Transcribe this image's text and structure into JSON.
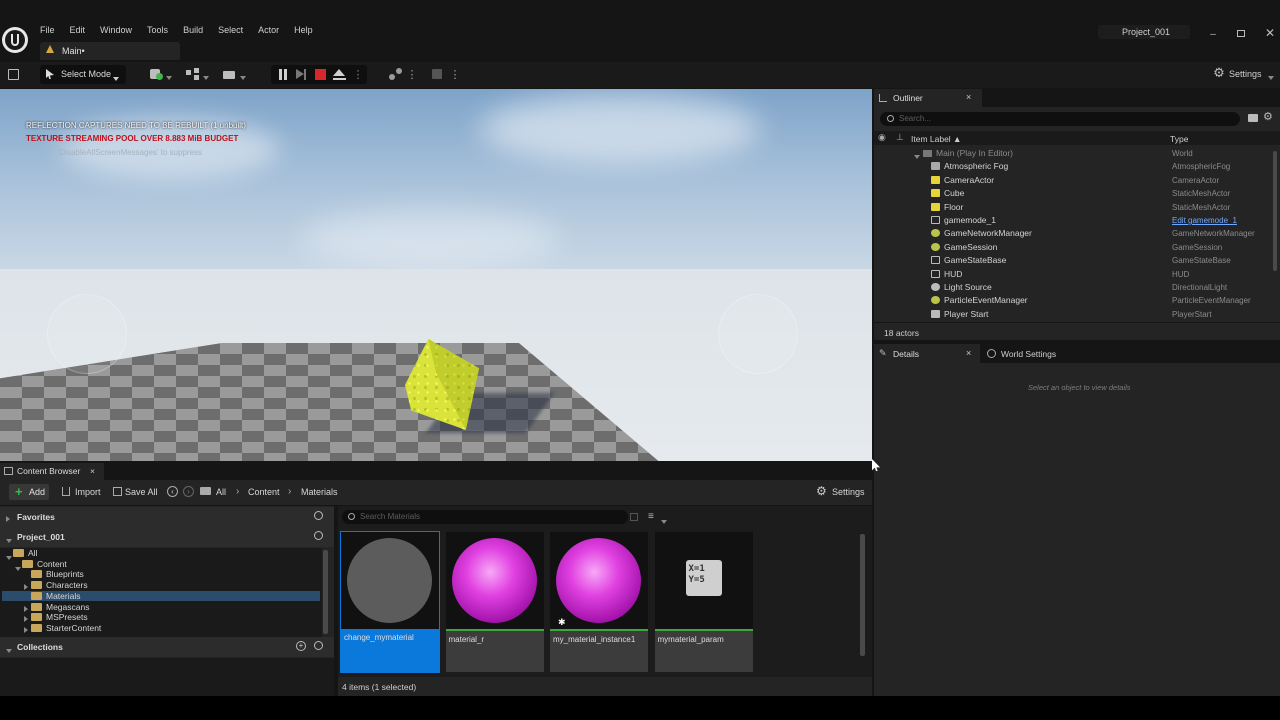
{
  "app": {
    "project_name": "Project_001",
    "tab_label": "Main•"
  },
  "menu": [
    "File",
    "Edit",
    "Window",
    "Tools",
    "Build",
    "Select",
    "Actor",
    "Help"
  ],
  "toolbar": {
    "select_mode": "Select Mode",
    "settings": "Settings"
  },
  "viewport": {
    "messages": [
      "REFLECTION CAPTURES NEED TO BE REBUILT (1 unbuilt)",
      "TEXTURE STREAMING POOL OVER 8.883 MiB BUDGET",
      "'DisableAllScreenMessages' to suppress"
    ]
  },
  "outliner": {
    "tab": "Outliner",
    "search_placeholder": "Search...",
    "col_label": "Item Label ▲",
    "col_type": "Type",
    "root": {
      "label": "Main (Play In Editor)",
      "type": "World"
    },
    "rows": [
      {
        "label": "Atmospheric Fog",
        "type": "AtmosphericFog",
        "icon": "fog-icon"
      },
      {
        "label": "CameraActor",
        "type": "CameraActor",
        "icon": "camera-icon"
      },
      {
        "label": "Cube",
        "type": "StaticMeshActor",
        "icon": "mesh-icon"
      },
      {
        "label": "Floor",
        "type": "StaticMeshActor",
        "icon": "mesh-icon"
      },
      {
        "label": "gamemode_1",
        "type": "Edit gamemode_1",
        "icon": "gamemode-icon",
        "link": true
      },
      {
        "label": "GameNetworkManager",
        "type": "GameNetworkManager",
        "icon": "actor-icon"
      },
      {
        "label": "GameSession",
        "type": "GameSession",
        "icon": "actor-icon"
      },
      {
        "label": "GameStateBase",
        "type": "GameStateBase",
        "icon": "gamestate-icon"
      },
      {
        "label": "HUD",
        "type": "HUD",
        "icon": "hud-icon"
      },
      {
        "label": "Light Source",
        "type": "DirectionalLight",
        "icon": "light-icon"
      },
      {
        "label": "ParticleEventManager",
        "type": "ParticleEventManager",
        "icon": "actor-icon"
      },
      {
        "label": "Player Start",
        "type": "PlayerStart",
        "icon": "player-start-icon"
      }
    ],
    "count": "18 actors"
  },
  "details": {
    "tab": "Details",
    "world_tab": "World Settings",
    "hint": "Select an object to view details"
  },
  "content_browser": {
    "tab": "Content Browser",
    "add": "Add",
    "import": "Import",
    "save_all": "Save All",
    "breadcrumb": [
      "All",
      "Content",
      "Materials"
    ],
    "settings": "Settings",
    "favorites": "Favorites",
    "project": "Project_001",
    "collections": "Collections",
    "search_placeholder": "Search Materials",
    "tree": [
      {
        "label": "All",
        "depth": 0,
        "open": true
      },
      {
        "label": "Content",
        "depth": 1,
        "open": true
      },
      {
        "label": "Blueprints",
        "depth": 2
      },
      {
        "label": "Characters",
        "depth": 2,
        "arrow": true
      },
      {
        "label": "Materials",
        "depth": 2,
        "selected": true
      },
      {
        "label": "Megascans",
        "depth": 2,
        "arrow": true
      },
      {
        "label": "MSPresets",
        "depth": 2,
        "arrow": true
      },
      {
        "label": "StarterContent",
        "depth": 2,
        "arrow": true
      }
    ],
    "assets": [
      {
        "name": "change_mymaterial",
        "kind": "gray-sphere",
        "selected": true
      },
      {
        "name": "material_r",
        "kind": "pink-sphere"
      },
      {
        "name": "my_material_instance1",
        "kind": "pink-sphere",
        "star": true
      },
      {
        "name": "mymaterial_param",
        "kind": "param",
        "param_text": "X=1\nY=5"
      }
    ],
    "status": "4 items (1 selected)"
  },
  "colors": {
    "accent_blue": "#0b78dc",
    "warning_red": "#c0101a",
    "play_red": "#d8272b",
    "folder": "#c9a75a"
  }
}
